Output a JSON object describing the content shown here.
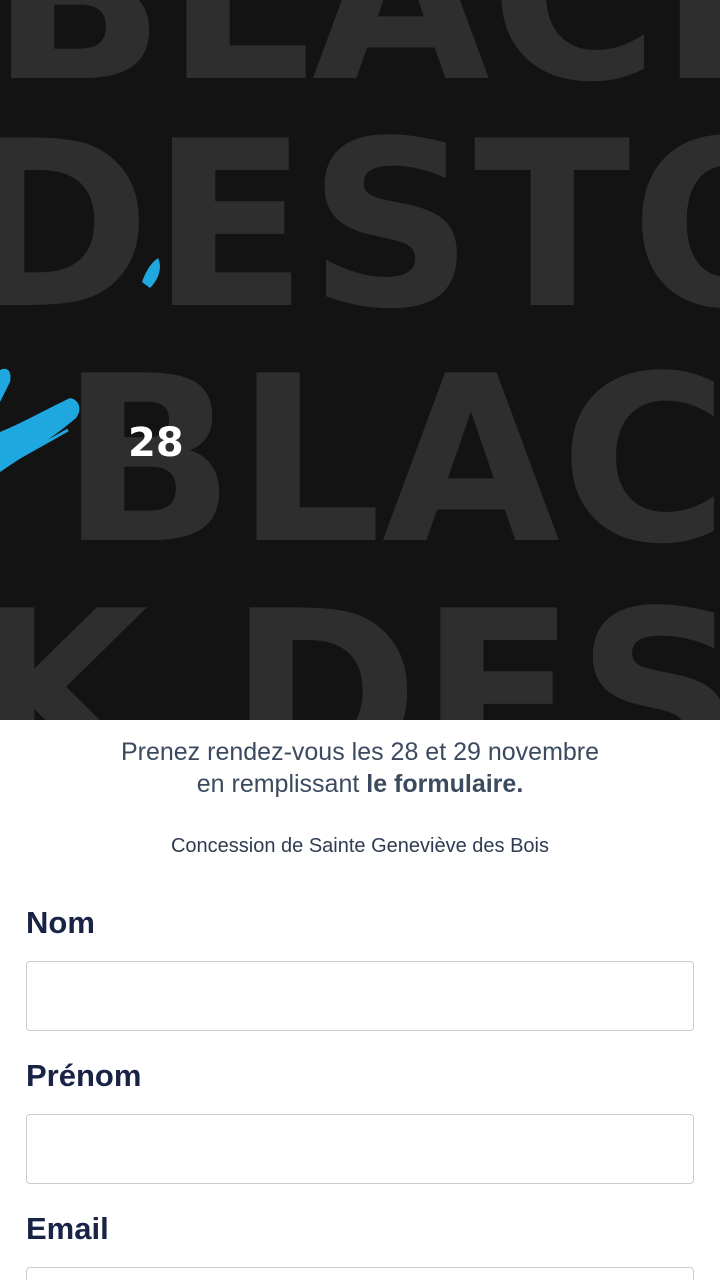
{
  "hero": {
    "background_color": "#131313",
    "background_words": [
      "BLACK D",
      "DESTOC",
      "BLACK",
      "K DEST"
    ],
    "date_badge": "28",
    "accent_color": "#1fa8e0"
  },
  "intro": {
    "line1": "Prenez rendez-vous les 28 et 29 novembre",
    "line2_prefix": "en remplissant ",
    "line2_bold": "le formulaire."
  },
  "location": "Concession de Sainte Geneviève des Bois",
  "form": {
    "nom_label": "Nom",
    "nom_value": "",
    "prenom_label": "Prénom",
    "prenom_value": "",
    "email_label": "Email",
    "email_value": ""
  }
}
